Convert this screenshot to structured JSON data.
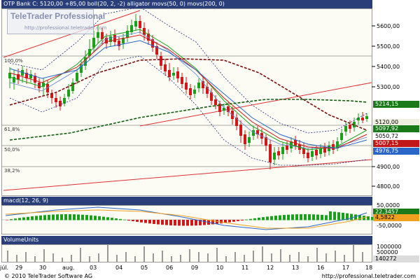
{
  "price_panel": {
    "title": "OTP Bank C: 5120,00 +85,00 boll(20, 2, -2) alligator movs(50, 0) movs(200, 0)",
    "y_ticks": [
      "5600,00",
      "5500,00",
      "5400,00",
      "5300,00",
      "4900,00",
      "4800,00"
    ],
    "flags": [
      {
        "label": "5214,15",
        "bg": "#1a7a1a",
        "fg": "#ffffff"
      },
      {
        "label": "5120,00",
        "bg": "#f0f0e0",
        "fg": "#000000"
      },
      {
        "label": "5097,92",
        "bg": "#1a7a1a",
        "fg": "#ffffff"
      },
      {
        "label": "5050,72",
        "bg": "#ffffff",
        "fg": "#000000"
      },
      {
        "label": "5007,15",
        "bg": "#c01818",
        "fg": "#ffffff"
      },
      {
        "label": "4976,75",
        "bg": "#2a66c8",
        "fg": "#ffffff"
      }
    ],
    "fib_labels": [
      "100,0%",
      "61,8%",
      "50,0%",
      "38,2%"
    ]
  },
  "macd_panel": {
    "title": "macd(12, 26, 9)",
    "y_ticks": [
      "50,0000",
      "-50,0000"
    ],
    "flags": [
      {
        "label": "22,3457",
        "bg": "#1a7a1a",
        "fg": "#ffffff"
      },
      {
        "label": "4,5822",
        "bg": "#f0a020",
        "fg": "#000000"
      }
    ]
  },
  "volume_panel": {
    "title": "VolumeUnits",
    "y_ticks": [
      "1000000",
      "500000"
    ],
    "flags": [
      {
        "label": "140272",
        "bg": "#dcdcdc",
        "fg": "#000000"
      }
    ]
  },
  "x_labels": [
    "júl.",
    "29",
    "30",
    "aug.",
    "03",
    "04",
    "05",
    "06",
    "09",
    "10",
    "11",
    "12",
    "13",
    "16",
    "17",
    "18"
  ],
  "logo": {
    "title": "TeleTrader Professional",
    "url": "http://professional.teletrader.com"
  },
  "footer": {
    "copyright": "© 2010 TeleTrader Software AG",
    "url": "http://professional.teletrader.com"
  },
  "colors": {
    "title_bar": "#2a3f7a",
    "up_candle": "#1aa01a",
    "down_candle": "#d01818",
    "boll": "#1e2a8a",
    "trendline": "#e03030",
    "mov50": "#7a1010",
    "mov200": "#106010"
  }
}
